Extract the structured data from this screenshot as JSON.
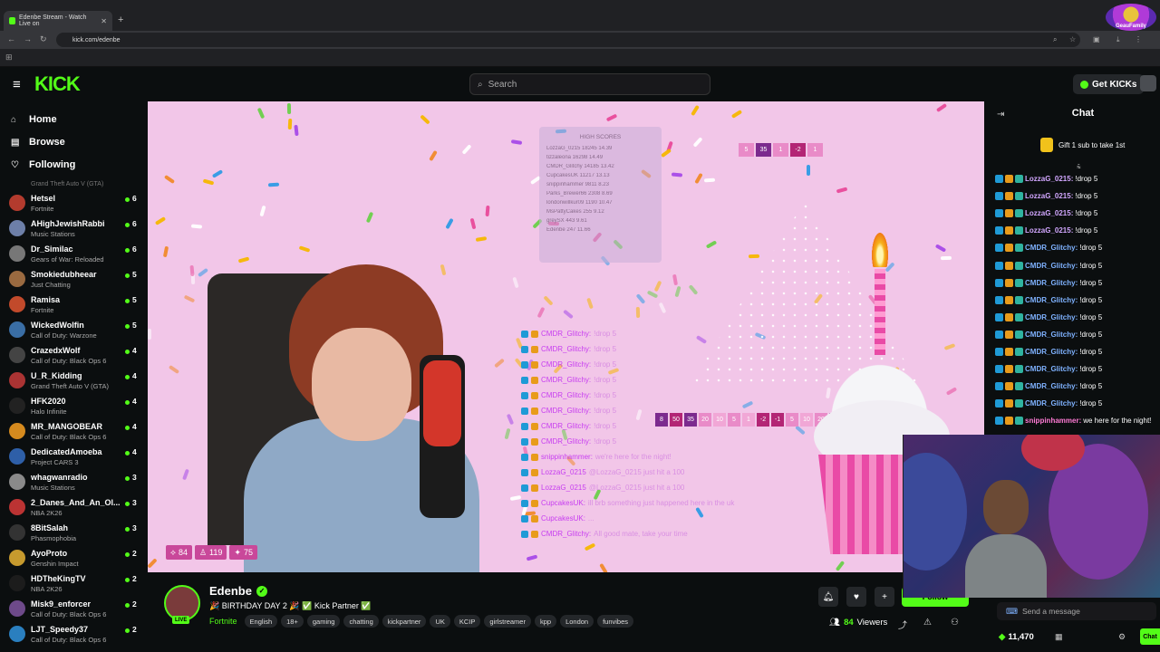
{
  "browser": {
    "tab_title": "Edenbe Stream - Watch Live on",
    "tab_close": "✕",
    "new_tab": "+",
    "url": "kick.com/edenbe",
    "profile_label": "GeauFamily"
  },
  "header": {
    "logo": "KICK",
    "search_placeholder": "Search",
    "get_kicks": "Get KICKs"
  },
  "sidebar": {
    "nav": [
      {
        "label": "Home",
        "icon": "home-icon"
      },
      {
        "label": "Browse",
        "icon": "browse-icon"
      },
      {
        "label": "Following",
        "icon": "heart-icon"
      }
    ],
    "partial_top": "Grand Theft Auto V (GTA)",
    "channels": [
      {
        "name": "Hetsel",
        "game": "Fortnite",
        "count": "6",
        "color": "#b33b2e"
      },
      {
        "name": "AHighJewishRabbi",
        "game": "Music Stations",
        "count": "6",
        "color": "#6d7fa8"
      },
      {
        "name": "Dr_Similac",
        "game": "Gears of War: Reloaded",
        "count": "6",
        "color": "#777"
      },
      {
        "name": "Smokiedubheear",
        "game": "Just Chatting",
        "count": "5",
        "color": "#9a6a40"
      },
      {
        "name": "Ramisa",
        "game": "Fortnite",
        "count": "5",
        "color": "#c24a2b"
      },
      {
        "name": "WickedWolfin",
        "game": "Call of Duty: Warzone",
        "count": "5",
        "color": "#3a6ea5"
      },
      {
        "name": "CrazedxWolf",
        "game": "Call of Duty: Black Ops 6",
        "count": "4",
        "color": "#444"
      },
      {
        "name": "U_R_Kidding",
        "game": "Grand Theft Auto V (GTA)",
        "count": "4",
        "color": "#a33"
      },
      {
        "name": "HFK2020",
        "game": "Halo Infinite",
        "count": "4",
        "color": "#222"
      },
      {
        "name": "MR_MANGOBEAR",
        "game": "Call of Duty: Black Ops 6",
        "count": "4",
        "color": "#d58a1e"
      },
      {
        "name": "DedicatedAmoeba",
        "game": "Project CARS 3",
        "count": "4",
        "color": "#2e5fa8"
      },
      {
        "name": "whagwanradio",
        "game": "Music Stations",
        "count": "3",
        "color": "#8a8a8a"
      },
      {
        "name": "2_Danes_And_An_Ol...",
        "game": "NBA 2K26",
        "count": "3",
        "color": "#b33"
      },
      {
        "name": "8BitSalah",
        "game": "Phasmophobia",
        "count": "3",
        "color": "#333"
      },
      {
        "name": "AyoProto",
        "game": "Genshin Impact",
        "count": "2",
        "color": "#c69a2e"
      },
      {
        "name": "HDTheKingTV",
        "game": "NBA 2K26",
        "count": "2",
        "color": "#1c1c1c"
      },
      {
        "name": "Misk9_enforcer",
        "game": "Call of Duty: Black Ops 6",
        "count": "2",
        "color": "#6e4a8a"
      },
      {
        "name": "LJT_Speedy37",
        "game": "Call of Duty: Black Ops 6",
        "count": "2",
        "color": "#2a7fbf"
      }
    ]
  },
  "video": {
    "overlay_title": "HIGH SCORES",
    "leaderboard": [
      "LozzaG_0215  18245  14.39",
      "tizzaleona  16298  14.49",
      "CMDR_Glitchy  14185  13.42",
      "CupcakesUK  11217  13.13",
      "snippinhammer  9811  8.23",
      "Parks_Brewer66  2308  8.69",
      "londonwillkur09  1190  10.47",
      "MsPattyCakes  255  9.12",
      "greySX  443  9.61",
      "Edenbe  247  11.66"
    ],
    "top_numbers": [
      "5",
      "35",
      "1",
      "-2",
      "1"
    ],
    "mid_numbers": [
      "8",
      "50",
      "35",
      "20",
      "10",
      "5",
      "1",
      "-2",
      "-1",
      "5",
      "10",
      "20",
      "35",
      "50",
      "8"
    ],
    "overlay_chat": [
      {
        "user": "CMDR_Glitchy:",
        "msg": "!drop 5"
      },
      {
        "user": "CMDR_Glitchy:",
        "msg": "!drop 5"
      },
      {
        "user": "CMDR_Glitchy:",
        "msg": "!drop 5"
      },
      {
        "user": "CMDR_Glitchy:",
        "msg": "!drop 5"
      },
      {
        "user": "CMDR_Glitchy:",
        "msg": "!drop 5"
      },
      {
        "user": "CMDR_Glitchy:",
        "msg": "!drop 5"
      },
      {
        "user": "CMDR_Glitchy:",
        "msg": "!drop 5"
      },
      {
        "user": "CMDR_Glitchy:",
        "msg": "!drop 5"
      },
      {
        "user": "snippinhammer:",
        "msg": "we're here for the night!"
      },
      {
        "user": "LozzaG_0215",
        "msg": "@LozzaG_0215 just hit a 100"
      },
      {
        "user": "LozzaG_0215",
        "msg": "@LozzaG_0215 just hit a 100"
      },
      {
        "user": "CupcakesUK:",
        "msg": "ill brb something just happened here in the uk"
      },
      {
        "user": "CupcakesUK:",
        "msg": "..."
      },
      {
        "user": "CMDR_Glitchy:",
        "msg": "All good mate, take your time"
      }
    ],
    "badges": [
      "84",
      "119",
      "75"
    ]
  },
  "channel": {
    "name": "Edenbe",
    "live": "LIVE",
    "title": "🎉 BIRTHDAY DAY 2 🎉 ✅ Kick Partner ✅",
    "game": "Fortnite",
    "tags": [
      "English",
      "18+",
      "gaming",
      "chatting",
      "kickpartner",
      "UK",
      "KCIP",
      "girlstreamer",
      "kpp",
      "London",
      "funvibes"
    ],
    "viewers": "84",
    "viewers_label": "Viewers",
    "follow_label": "Follow"
  },
  "chat": {
    "title": "Chat",
    "gift_banner": "Gift 1 sub to take 1st",
    "messages": [
      {
        "user": "LozzaG_0215:",
        "text": "!drop 5",
        "color": "#d2a7ff"
      },
      {
        "user": "LozzaG_0215:",
        "text": "!drop 5",
        "color": "#d2a7ff"
      },
      {
        "user": "LozzaG_0215:",
        "text": "!drop 5",
        "color": "#d2a7ff"
      },
      {
        "user": "LozzaG_0215:",
        "text": "!drop 5",
        "color": "#d2a7ff"
      },
      {
        "user": "CMDR_Glitchy:",
        "text": "!drop 5",
        "color": "#7fb2ff"
      },
      {
        "user": "CMDR_Glitchy:",
        "text": "!drop 5",
        "color": "#7fb2ff"
      },
      {
        "user": "CMDR_Glitchy:",
        "text": "!drop 5",
        "color": "#7fb2ff"
      },
      {
        "user": "CMDR_Glitchy:",
        "text": "!drop 5",
        "color": "#7fb2ff"
      },
      {
        "user": "CMDR_Glitchy:",
        "text": "!drop 5",
        "color": "#7fb2ff"
      },
      {
        "user": "CMDR_Glitchy:",
        "text": "!drop 5",
        "color": "#7fb2ff"
      },
      {
        "user": "CMDR_Glitchy:",
        "text": "!drop 5",
        "color": "#7fb2ff"
      },
      {
        "user": "CMDR_Glitchy:",
        "text": "!drop 5",
        "color": "#7fb2ff"
      },
      {
        "user": "CMDR_Glitchy:",
        "text": "!drop 5",
        "color": "#7fb2ff"
      },
      {
        "user": "CMDR_Glitchy:",
        "text": "!drop 5",
        "color": "#7fb2ff"
      },
      {
        "user": "snippinhammer:",
        "text": "we here for the night!",
        "color": "#ff7bd5"
      }
    ],
    "input_placeholder": "Send a message",
    "kicks_count": "11,470",
    "send_label": "Chat"
  },
  "colors": {
    "accent": "#53fc18",
    "video_bg": "#f2c6e8"
  }
}
